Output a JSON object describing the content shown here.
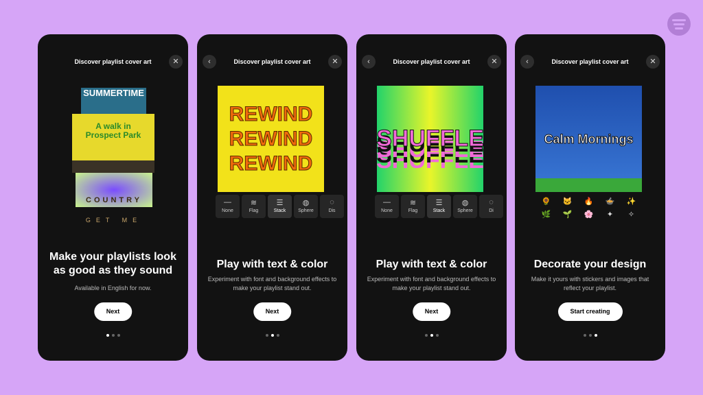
{
  "header_title": "Discover playlist cover art",
  "colors": {
    "background": "#d6a5f7",
    "card": "#121212",
    "brand": "#b27fd6"
  },
  "cards": [
    {
      "title": "Make your playlists look as good as they sound",
      "subtitle": "Available in English for now.",
      "button": "Next",
      "page": 1,
      "art_texts": [
        "SUMMERTIME",
        "A walk in Prospect Park",
        "COUNTRY",
        "GET ME"
      ]
    },
    {
      "title": "Play with text & color",
      "subtitle": "Experiment with font and background effects to make your playlist stand out.",
      "button": "Next",
      "page": 2,
      "art_text": "REWIND",
      "effects": [
        "None",
        "Flag",
        "Stack",
        "Sphere",
        "Dis"
      ],
      "selected_effect": "Stack"
    },
    {
      "title": "Play with text & color",
      "subtitle": "Experiment with font and background effects to make your playlist stand out.",
      "button": "Next",
      "page": 2,
      "art_text": "SHUFFLE",
      "effects": [
        "None",
        "Flag",
        "Stack",
        "Sphere",
        "Di"
      ],
      "selected_effect": "Stack"
    },
    {
      "title": "Decorate your design",
      "subtitle": "Make it yours with stickers and images that reflect your playlist.",
      "button": "Start creating",
      "page": 3,
      "art_text": "Calm Mornings",
      "stickers": [
        "🌻",
        "🐱",
        "🔥",
        "🍲",
        "✨",
        "🌿",
        "🌱",
        "🌸",
        "✦",
        "✧"
      ]
    }
  ]
}
